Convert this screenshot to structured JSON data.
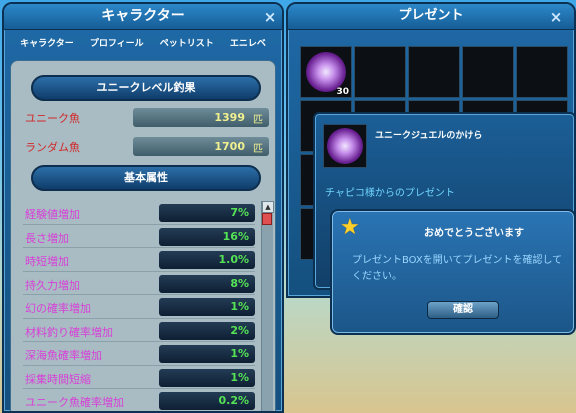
{
  "character_window": {
    "title": "キャラクター",
    "close_glyph": "×",
    "tabs": [
      {
        "label": "キャラクター"
      },
      {
        "label": "プロフィール"
      },
      {
        "label": "ペットリスト"
      },
      {
        "label": "エニレベ"
      }
    ],
    "unique_level_section": "ユニークレベル釣果",
    "fish_rows": [
      {
        "label": "ユニーク魚",
        "value": "1399",
        "unit": "匹"
      },
      {
        "label": "ランダム魚",
        "value": "1700",
        "unit": "匹"
      }
    ],
    "basic_attr_section": "基本属性",
    "attributes": [
      {
        "label": "経験値増加",
        "value": "7%"
      },
      {
        "label": "長さ増加",
        "value": "16%"
      },
      {
        "label": "時短増加",
        "value": "1.0%"
      },
      {
        "label": "持久力増加",
        "value": "8%"
      },
      {
        "label": "幻の確率増加",
        "value": "1%"
      },
      {
        "label": "材料釣り確率増加",
        "value": "2%"
      },
      {
        "label": "深海魚確率増加",
        "value": "1%"
      },
      {
        "label": "採集時間短縮",
        "value": "1%"
      },
      {
        "label": "ユニーク魚確率増加",
        "value": "0.2%"
      }
    ],
    "scroll_up_glyph": "▲"
  },
  "present_window": {
    "title": "プレゼント",
    "close_glyph": "×",
    "first_item_count": "30"
  },
  "item_popup": {
    "name": "ユニークジュエルのかけら",
    "from_text": "チャピコ様からのプレゼント"
  },
  "congrats_dialog": {
    "title": "おめでとうございます",
    "body": "プレゼントBOXを開いてプレゼントを確認してください。",
    "confirm_label": "確認",
    "icon": "star-icon"
  },
  "colors": {
    "panel_blue": "#1f6aa8",
    "attr_label": "#d83fd8",
    "attr_value": "#55e255",
    "fish_label": "#d02828",
    "fish_value": "#f0f090"
  }
}
